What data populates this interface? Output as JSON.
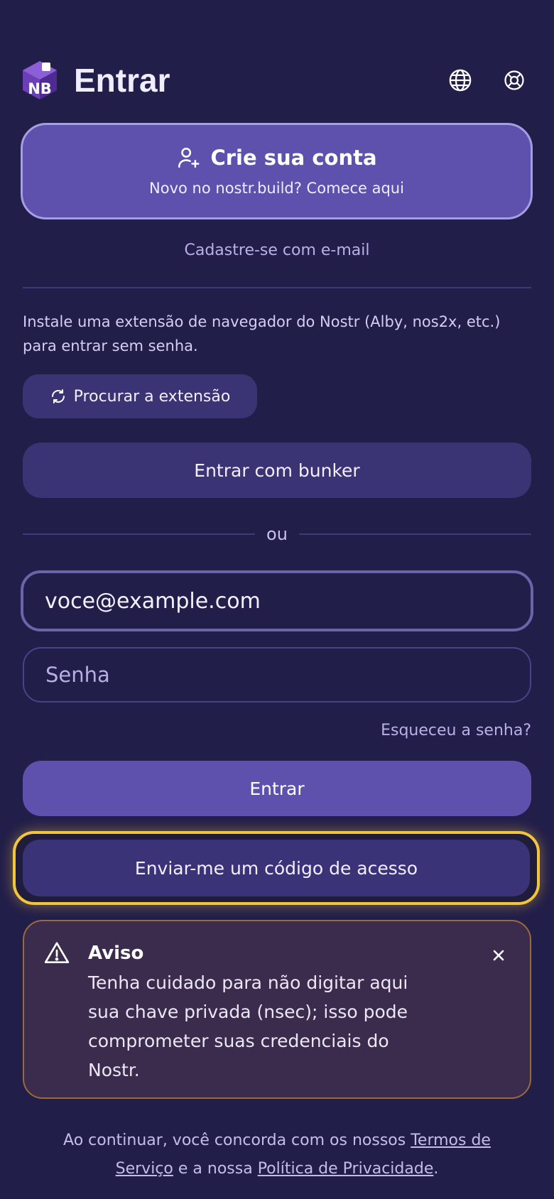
{
  "header": {
    "logo_text": "NB",
    "title": "Entrar",
    "icons": [
      "globe-icon",
      "lifebuoy-icon"
    ]
  },
  "create_account": {
    "title": "Crie sua conta",
    "subtitle": "Novo no nostr.build? Comece aqui",
    "icon": "user-plus-icon"
  },
  "email_signup_link": "Cadastre-se com e-mail",
  "extension": {
    "info": "Instale uma extensão de navegador do Nostr (Alby, nos2x, etc.) para entrar sem senha.",
    "scan_label": "Procurar a extensão",
    "scan_icon": "refresh-icon"
  },
  "bunker_label": "Entrar com bunker",
  "or_label": "ou",
  "form": {
    "email_value": "voce@example.com",
    "password_placeholder": "Senha",
    "forgot_label": "Esqueceu a senha?",
    "login_label": "Entrar",
    "code_label": "Enviar-me um código de acesso"
  },
  "warning": {
    "title": "Aviso",
    "text": "Tenha cuidado para não digitar aqui sua chave privada (nsec); isso pode comprometer suas credenciais do Nostr.",
    "icon": "warning-triangle-icon"
  },
  "footer": {
    "prefix": "Ao continuar, você concorda com os nossos ",
    "terms_label": "Termos de Serviço",
    "middle": " e a nossa ",
    "privacy_label": "Política de Privacidade",
    "suffix": "."
  },
  "colors": {
    "background": "#221e4a",
    "primary": "#5d51ad",
    "secondary": "#3b3474",
    "highlight": "#f3c53a",
    "warning_border": "#9c6a3a"
  }
}
